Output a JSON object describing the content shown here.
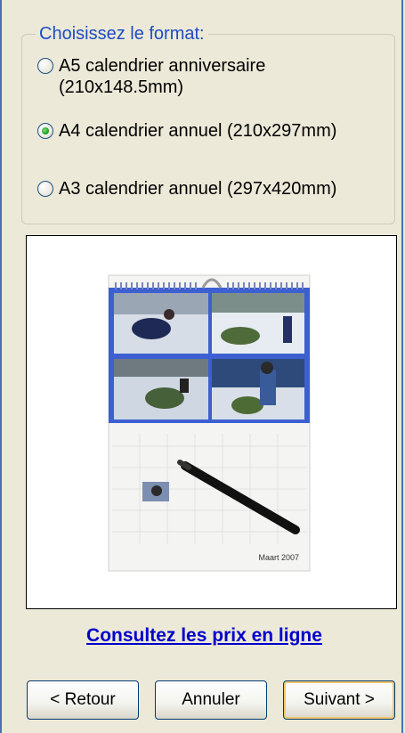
{
  "format": {
    "legend": "Choisissez le format:",
    "options": [
      {
        "label": "A5 calendrier anniversaire (210x148.5mm)",
        "checked": false
      },
      {
        "label": "A4 calendrier annuel (210x297mm)",
        "checked": true
      },
      {
        "label": "A3 calendrier annuel (297x420mm)",
        "checked": false
      }
    ]
  },
  "preview": {
    "caption": "Maart 2007"
  },
  "link": {
    "label": "Consultez les prix en ligne"
  },
  "buttons": {
    "back": "< Retour",
    "cancel": "Annuler",
    "next": "Suivant >"
  },
  "colors": {
    "legend": "#1f4bc6",
    "link": "#0000cc",
    "calendar_blue": "#3d5fd1"
  }
}
